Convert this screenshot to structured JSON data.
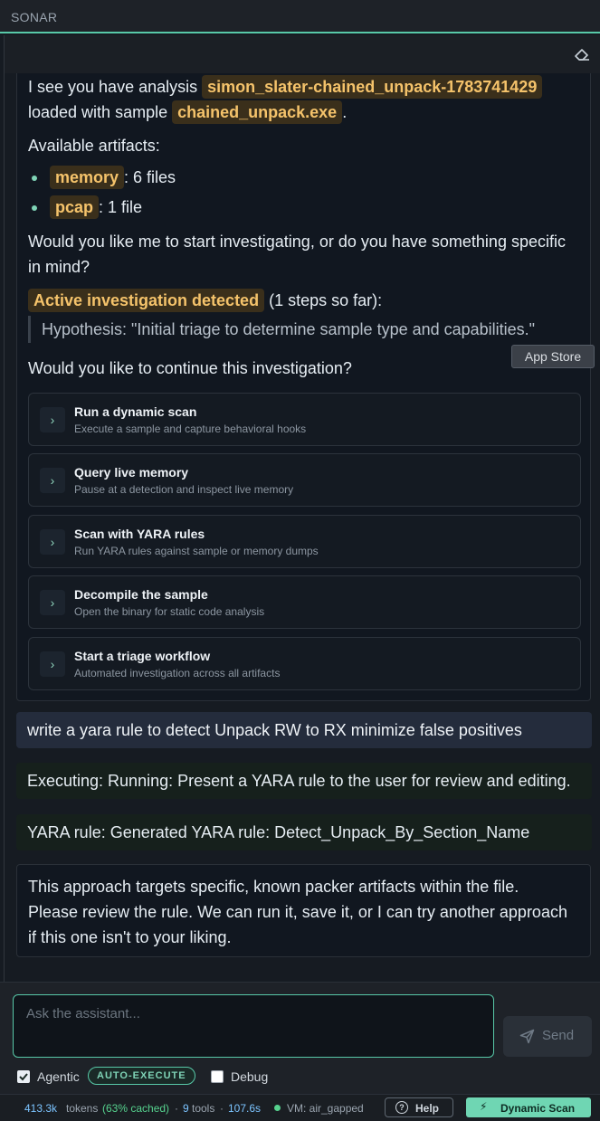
{
  "app": {
    "title": "SONAR"
  },
  "assistant": {
    "intro_prefix": "I see you have analysis",
    "analysis_id": "simon_slater-chained_unpack-1783741429",
    "intro_mid": "loaded with sample",
    "sample_name": "chained_unpack.exe",
    "intro_suffix": ".",
    "artifacts_heading": "Available artifacts:",
    "artifacts": [
      {
        "name": "memory",
        "count": ": 6 files"
      },
      {
        "name": "pcap",
        "count": ": 1 file"
      }
    ],
    "question_line1": "Would you like me to start investigating, or do you have something specific",
    "question_line2": "in mind?",
    "investigation_badge": "Active investigation detected",
    "investigation_steps": "(1 steps so far):",
    "hypothesis": "Hypothesis: \"Initial triage to determine sample type and capabilities.\"",
    "continue_question": "Would you like to continue this investigation?",
    "tooltip": "App Store",
    "actions": [
      {
        "title": "Run a dynamic scan",
        "desc": "Execute a sample and capture behavioral hooks"
      },
      {
        "title": "Query live memory",
        "desc": "Pause at a detection and inspect live memory"
      },
      {
        "title": "Scan with YARA rules",
        "desc": "Run YARA rules against sample or memory dumps"
      },
      {
        "title": "Decompile the sample",
        "desc": "Open the binary for static code analysis"
      },
      {
        "title": "Start a triage workflow",
        "desc": "Automated investigation across all artifacts"
      }
    ]
  },
  "user_message": "write a yara rule to detect Unpack RW to RX minimize false positives",
  "status_messages": [
    "Executing: Running: Present a YARA rule to the user for review and editing.",
    "YARA rule: Generated YARA rule: Detect_Unpack_By_Section_Name"
  ],
  "final_message": {
    "line1": "This approach targets specific, known packer artifacts within the file.",
    "line2": "Please review the rule. We can run it, save it, or I can try another approach",
    "line3": "if this one isn't to your liking."
  },
  "composer": {
    "placeholder": "Ask the assistant...",
    "value": "",
    "send_label": "Send",
    "agentic_label": "Agentic",
    "agentic_checked": true,
    "auto_execute_badge": "AUTO-EXECUTE",
    "debug_label": "Debug",
    "debug_checked": false
  },
  "footer": {
    "tokens": "413.3k",
    "tokens_label": "tokens",
    "cached": "(63% cached)",
    "sep1": "·",
    "tools": "9",
    "tools_label": "tools",
    "sep2": "·",
    "time": "107.6s",
    "vm": "VM: air_gapped",
    "help_label": "Help",
    "dynamic_scan_label": "Dynamic Scan"
  },
  "colors": {
    "accent": "#58c9a8",
    "chip_text": "#f5c36b",
    "chip_bg": "#3a2f1b",
    "dynamic_scan_bg": "#6fd6b3"
  },
  "icons": [
    "eraser-icon",
    "chevron-right-icon",
    "send-icon",
    "help-icon",
    "bolt-icon",
    "status-dot-icon",
    "checkbox-icon"
  ]
}
